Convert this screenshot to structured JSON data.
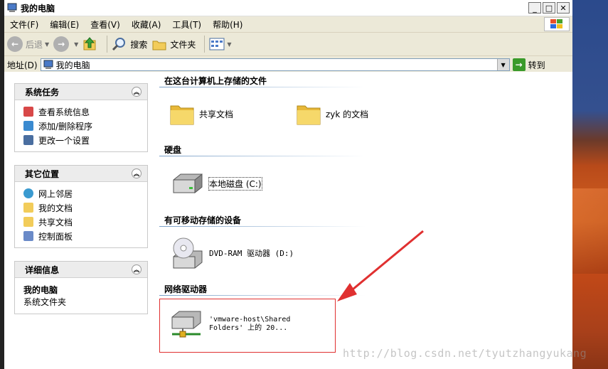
{
  "window": {
    "title": "我的电脑"
  },
  "menu": {
    "items": [
      "文件(F)",
      "编辑(E)",
      "查看(V)",
      "收藏(A)",
      "工具(T)",
      "帮助(H)"
    ]
  },
  "toolbar": {
    "back": "后退",
    "search": "搜索",
    "folders": "文件夹"
  },
  "address": {
    "label": "地址(D)",
    "value": "我的电脑",
    "go": "转到"
  },
  "tasks": {
    "system": {
      "title": "系统任务",
      "items": [
        "查看系统信息",
        "添加/删除程序",
        "更改一个设置"
      ]
    },
    "other": {
      "title": "其它位置",
      "items": [
        "网上邻居",
        "我的文档",
        "共享文档",
        "控制面板"
      ]
    },
    "details": {
      "title": "详细信息",
      "name": "我的电脑",
      "subtitle": "系统文件夹"
    }
  },
  "groups": {
    "files": {
      "title": "在这台计算机上存储的文件",
      "items": [
        "共享文档",
        "zyk 的文档"
      ]
    },
    "disks": {
      "title": "硬盘",
      "items": [
        "本地磁盘 (C:)"
      ]
    },
    "removable": {
      "title": "有可移动存储的设备",
      "items": [
        "DVD-RAM 驱动器 (D:)"
      ]
    },
    "network": {
      "title": "网络驱动器",
      "line1": "'vmware-host\\Shared",
      "line2": "Folders' 上的 20..."
    }
  },
  "watermark": "http://blog.csdn.net/tyutzhangyukang",
  "colors": {
    "highlight": "#e03030",
    "arrow": "#e03030"
  }
}
